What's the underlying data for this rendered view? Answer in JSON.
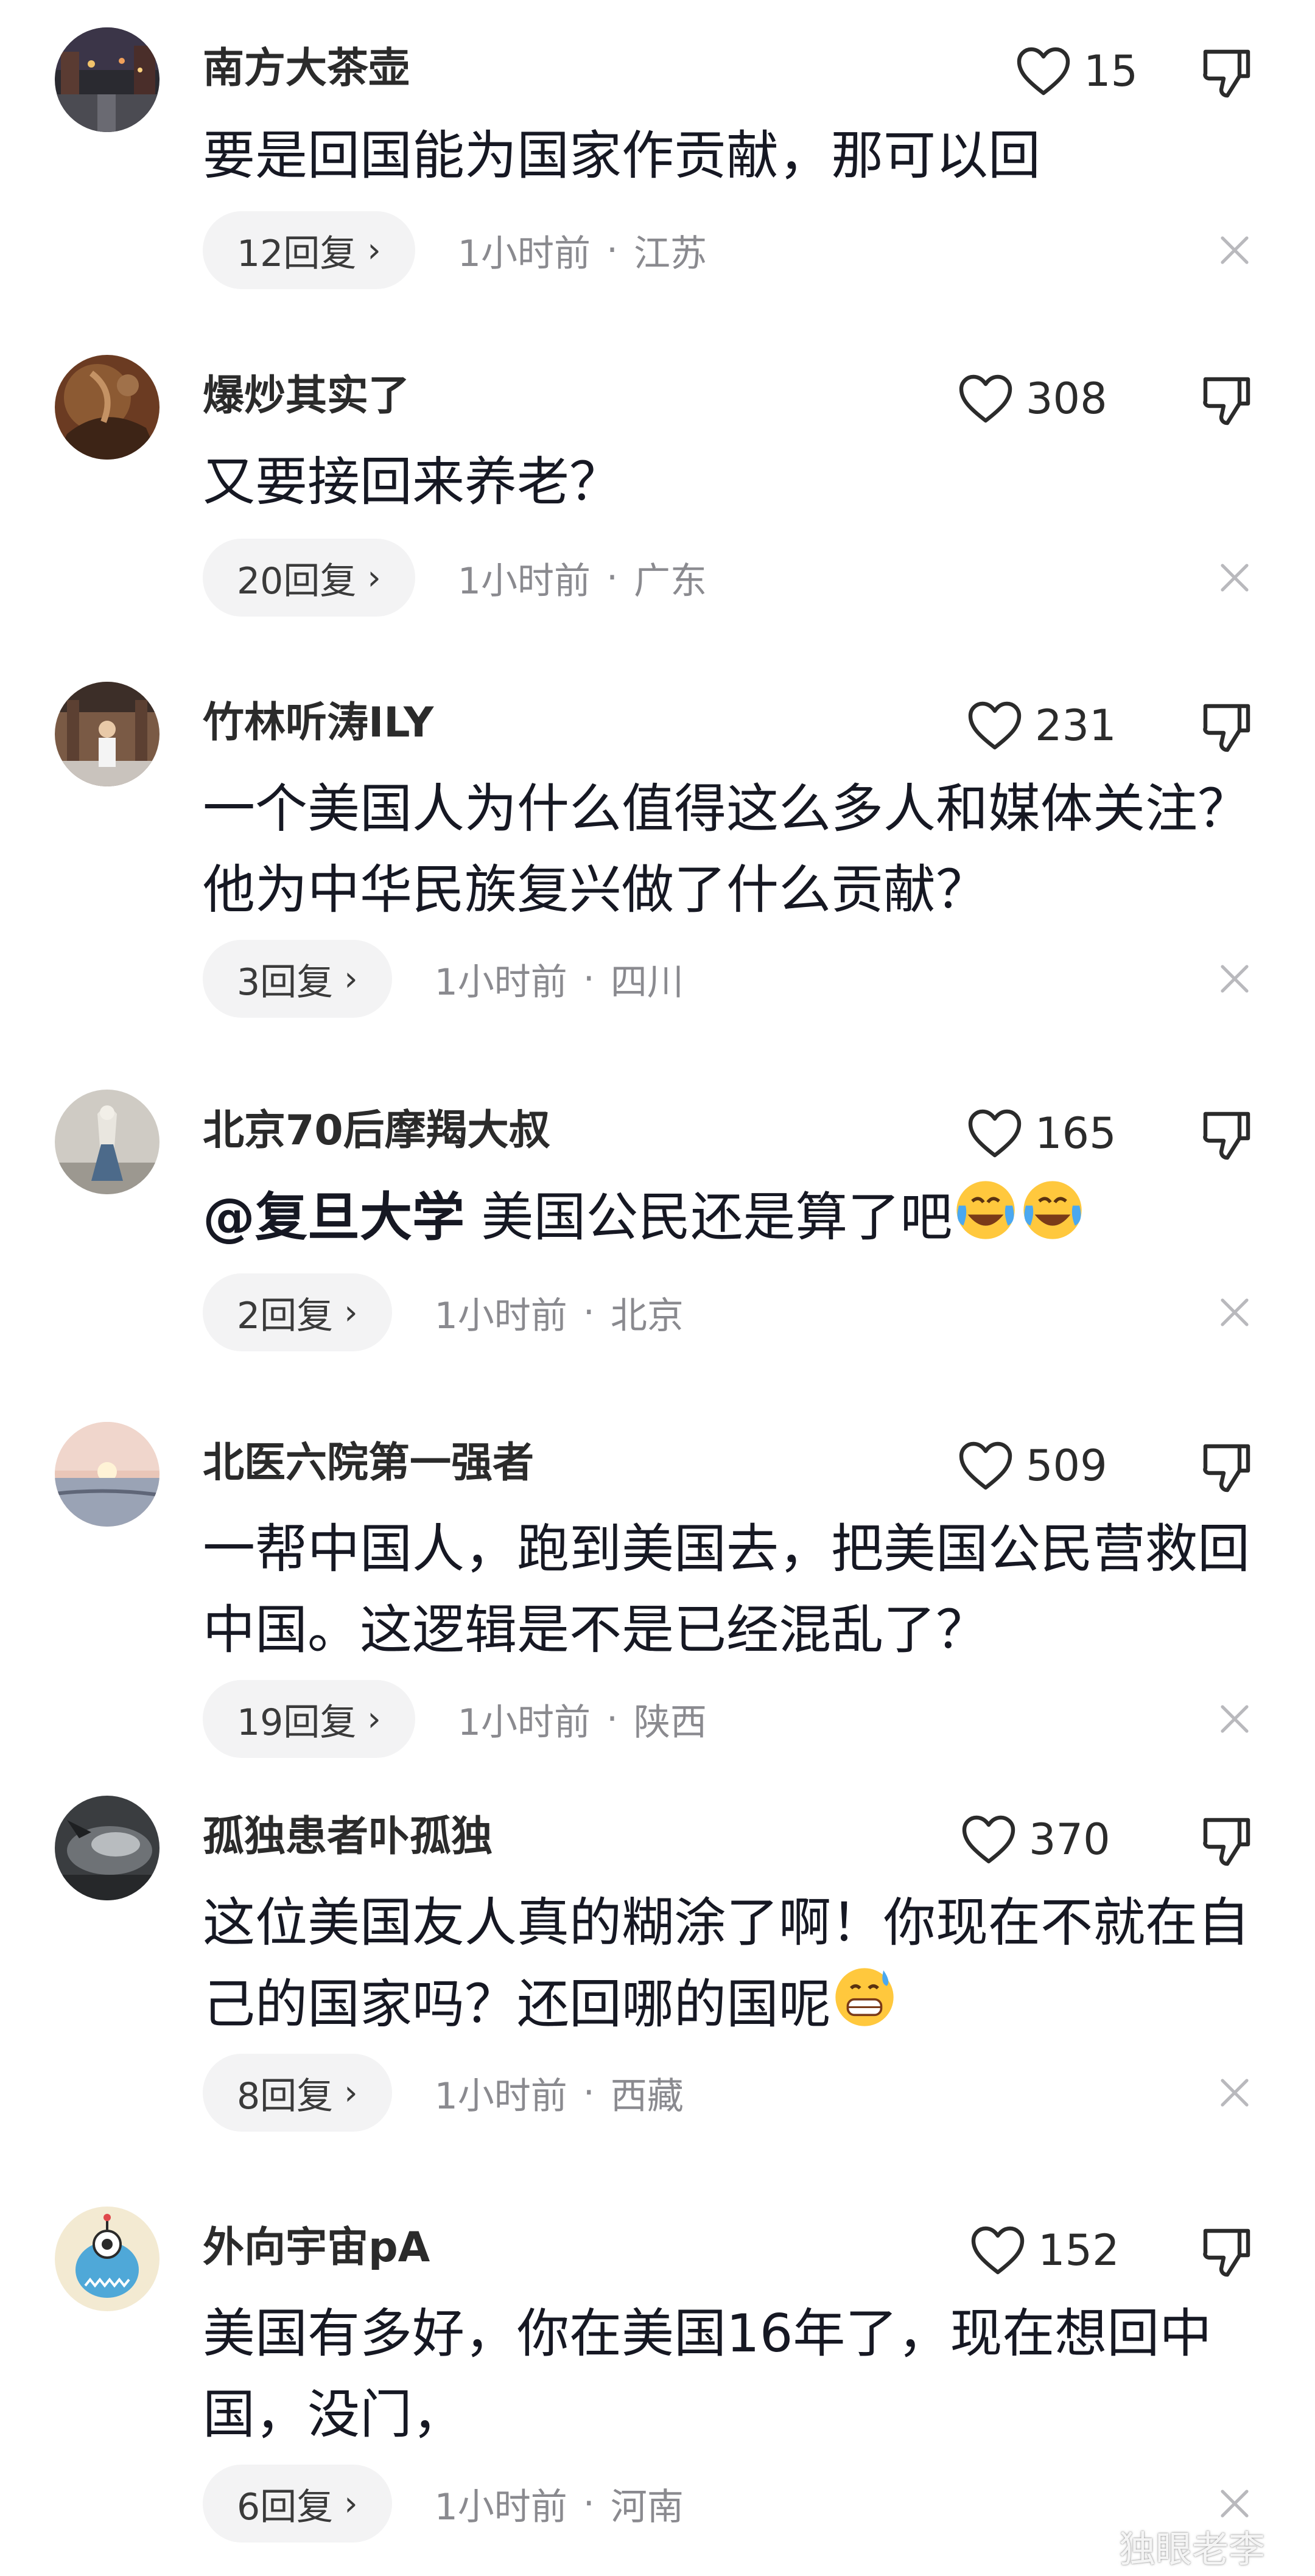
{
  "watermark": "独眼老李",
  "comments": [
    {
      "username": "南方大茶壶",
      "likes": "15",
      "lines": [
        "要是回国能为国家作贡献，那可以回"
      ],
      "replies": "12回复",
      "time": "1小时前",
      "location": "江苏",
      "avatar": "city-night-street"
    },
    {
      "username": "爆炒其实了",
      "likes": "308",
      "lines": [
        "又要接回来养老？"
      ],
      "replies": "20回复",
      "time": "1小时前",
      "location": "广东",
      "avatar": "ancient-painting"
    },
    {
      "username": "竹林听涛ILY",
      "likes": "231",
      "lines": [
        "一个美国人为什么值得这么多人和媒体关注？",
        "他为中华民族复兴做了什么贡献？"
      ],
      "replies": "3回复",
      "time": "1小时前",
      "location": "四川",
      "avatar": "man-at-temple"
    },
    {
      "username": "北京70后摩羯大叔",
      "likes": "165",
      "mention": "@复旦大学",
      "lines": [
        "美国公民还是算了吧"
      ],
      "emojis": [
        "laughing-crying-emoji",
        "laughing-crying-emoji"
      ],
      "replies": "2回复",
      "time": "1小时前",
      "location": "北京",
      "avatar": "statue"
    },
    {
      "username": "北医六院第一强者",
      "likes": "509",
      "lines": [
        "一帮中国人，跑到美国去，把美国公民营救回",
        "中国。这逻辑是不是已经混乱了？"
      ],
      "replies": "19回复",
      "time": "1小时前",
      "location": "陕西",
      "avatar": "sunset-lake"
    },
    {
      "username": "孤独患者卟孤独",
      "likes": "370",
      "lines": [
        "这位美国友人真的糊涂了啊！你现在不就在自",
        "己的国家吗？还回哪的国呢"
      ],
      "emojis": [
        "grin-sweat-emoji"
      ],
      "replies": "8回复",
      "time": "1小时前",
      "location": "西藏",
      "avatar": "misty-dark"
    },
    {
      "username": "外向宇宙pA",
      "likes": "152",
      "lines": [
        "美国有多好，你在美国16年了，现在想回中",
        "国，没门，"
      ],
      "replies": "6回复",
      "time": "1小时前",
      "location": "河南",
      "avatar": "cartoon-monster"
    }
  ],
  "colors": {
    "text_primary": "#161823",
    "text_secondary": "#8a8a8f",
    "pill_bg": "#f3f3f4"
  }
}
